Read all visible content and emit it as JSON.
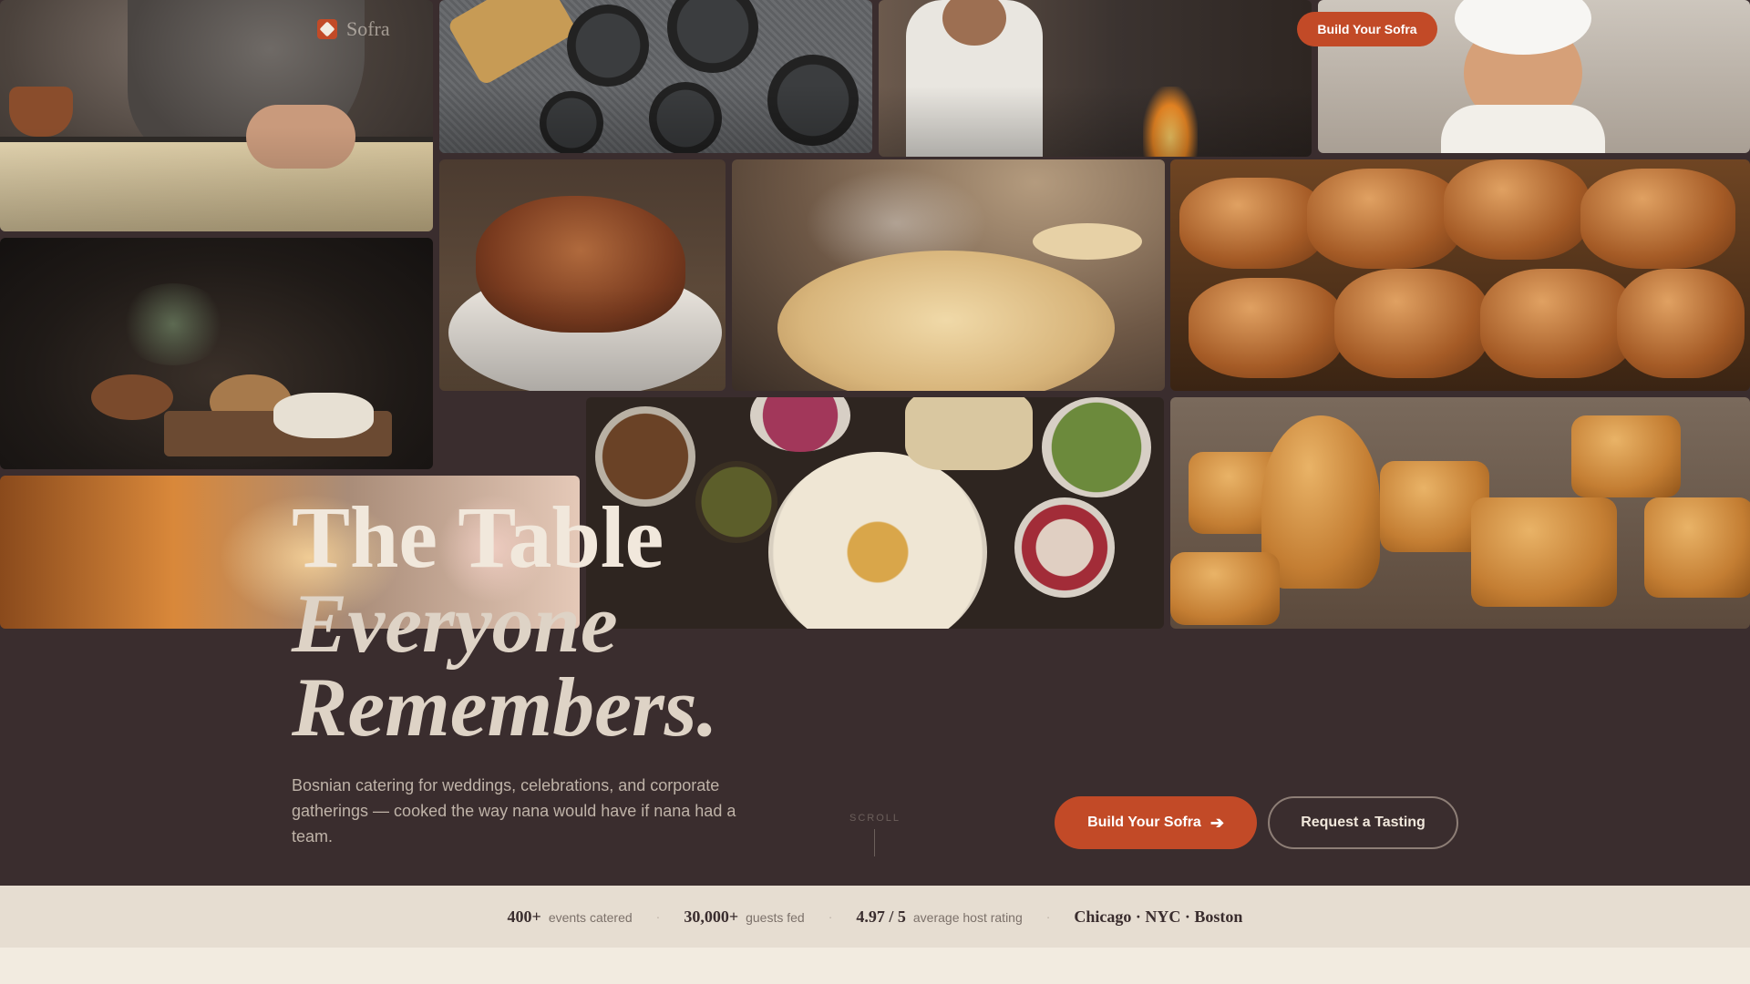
{
  "nav": {
    "brand": "Sofra",
    "links": [
      "",
      "",
      ""
    ],
    "cta_label": "Build Your Sofra"
  },
  "hero": {
    "headline_line1": "The Table",
    "headline_line2": "Everyone",
    "headline_line3": "Remembers.",
    "subtext": "Bosnian catering for weddings, celebrations, and corporate gatherings — cooked the way nana would have if nana had a team.",
    "scroll_label": "SCROLL",
    "primary_cta": "Build Your Sofra",
    "secondary_cta": "Request a Tasting",
    "photo_tiles": [
      "hands-rolling-dough-photo",
      "mezze-plates-photo",
      "chef-grilling-photo",
      "child-chef-photo",
      "still-life-bread-photo",
      "roast-lamb-photo",
      "flatbread-photo",
      "pastries-photo",
      "wedding-hall-photo",
      "hummus-spread-photo",
      "baklava-photo"
    ]
  },
  "stats": {
    "items": [
      {
        "value": "400+",
        "label": "events catered"
      },
      {
        "value": "30,000+",
        "label": "guests fed"
      },
      {
        "value": "4.97 / 5",
        "label": "average host rating"
      }
    ],
    "cities": "Chicago · NYC · Boston"
  },
  "colors": {
    "hero_bg": "#3a2d2e",
    "accent": "#c24a27",
    "strip_bg": "#e6ddd1",
    "page_bg": "#f2ebe0"
  },
  "icons": {
    "brand": "sofra-logo-icon",
    "cta_arrow": "arrow-right-icon"
  }
}
